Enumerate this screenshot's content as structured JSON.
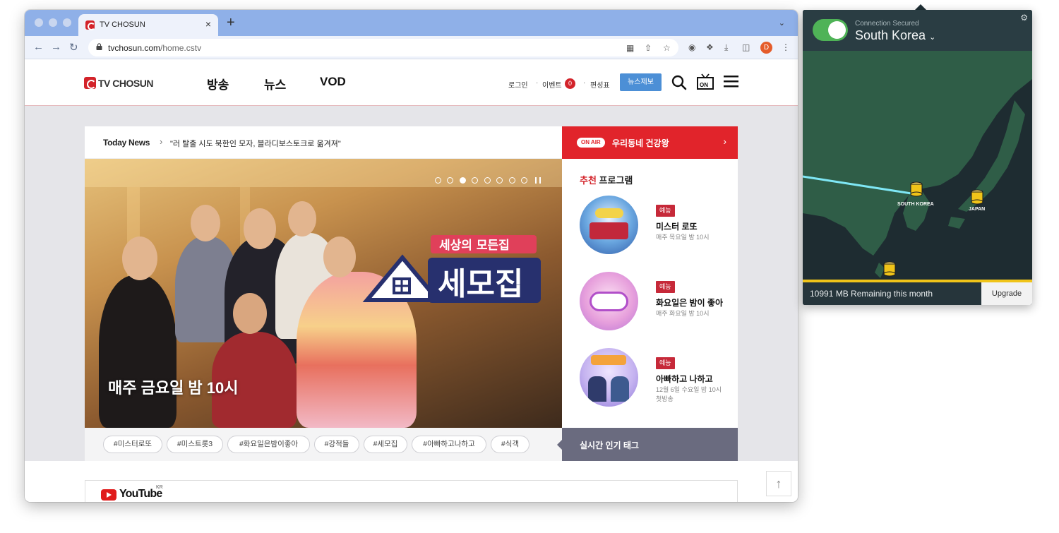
{
  "browser": {
    "tab_title": "TV CHOSUN",
    "url_host": "tvchosun.com",
    "url_path": "/home.cstv",
    "profile_initial": "D"
  },
  "site": {
    "logo_text": "TV CHOSUN",
    "nav": [
      "방송",
      "뉴스",
      "VOD"
    ],
    "util": {
      "login": "로그인",
      "event": "이벤트",
      "event_count": "0",
      "schedule": "편성표",
      "report": "뉴스제보"
    },
    "onair_icon_text": "ON",
    "today_news": {
      "label": "Today News",
      "headline": "\"러 탈출 시도 북한인 모자, 블라디보스토크로 옮겨져\""
    },
    "onair": {
      "badge": "ON AIR",
      "program": "우리동네 건강왕"
    },
    "hero": {
      "caption": "매주 금요일 밤 10시",
      "logo_small": "세상의 모든집",
      "logo_big": "세모집",
      "slide_count": 8,
      "active_slide": 3
    },
    "tags": [
      "#미스터로또",
      "#미스트롯3",
      "#화요일은밤이좋아",
      "#강적들",
      "#세모집",
      "#아빠하고나하고",
      "#식객"
    ],
    "popular_label": "실시간 인기 태그",
    "recommend": {
      "title_highlight": "추천",
      "title_rest": "프로그램",
      "items": [
        {
          "badge": "예능",
          "name": "미스터 로또",
          "schedule": "매주 목요일 밤 10시"
        },
        {
          "badge": "예능",
          "name": "화요일은 밤이 좋아",
          "schedule": "매주 화요일 밤 10시"
        },
        {
          "badge": "예능",
          "name": "아빠하고 나하고",
          "schedule": "12월 6일 수요일 밤 10시 첫방송"
        }
      ]
    },
    "youtube": {
      "word": "YouTube",
      "region": "KR"
    }
  },
  "vpn": {
    "status": "Connection Secured",
    "location": "South Korea",
    "labels": {
      "korea": "SOUTH KOREA",
      "japan": "JAPAN"
    },
    "remaining": "10991 MB Remaining this month",
    "upgrade": "Upgrade",
    "connected": true
  },
  "colors": {
    "brand_red": "#d3232a",
    "onair_red": "#e1242b",
    "report_blue": "#4c8fd6",
    "vpn_green": "#4fb357",
    "map_land": "#2f5d47"
  }
}
